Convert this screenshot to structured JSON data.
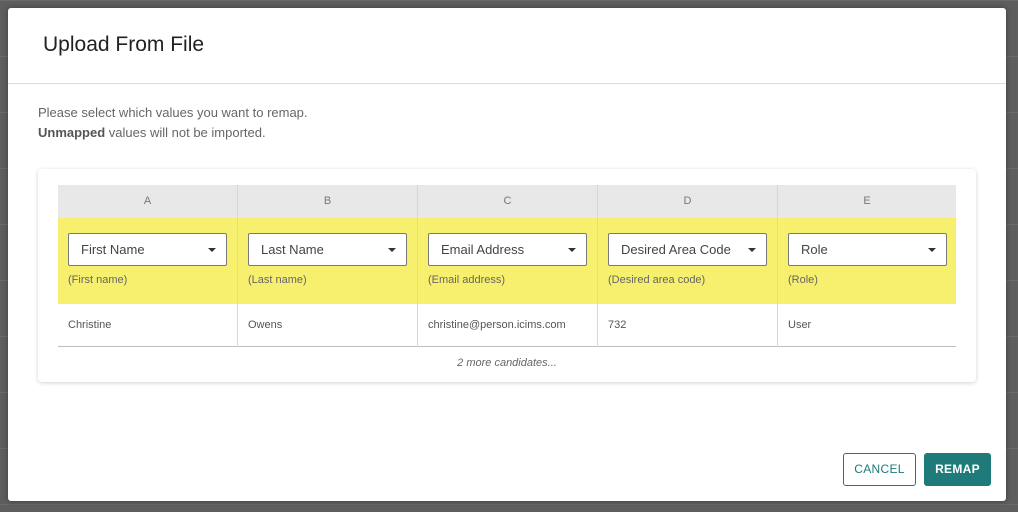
{
  "dialog": {
    "title": "Upload From File",
    "instruction_line1": "Please select which values you want to remap.",
    "instruction_bold": "Unmapped",
    "instruction_line2_rest": " values will not be imported."
  },
  "columns": [
    {
      "letter": "A",
      "selected": "First Name",
      "original": "(First name)",
      "sample": "Christine"
    },
    {
      "letter": "B",
      "selected": "Last Name",
      "original": "(Last name)",
      "sample": "Owens"
    },
    {
      "letter": "C",
      "selected": "Email Address",
      "original": "(Email address)",
      "sample": "christine@person.icims.com"
    },
    {
      "letter": "D",
      "selected": "Desired Area Code",
      "original": "(Desired area code)",
      "sample": "732"
    },
    {
      "letter": "E",
      "selected": "Role",
      "original": "(Role)",
      "sample": "User"
    }
  ],
  "more_text": "2 more candidates...",
  "buttons": {
    "cancel": "CANCEL",
    "remap": "REMAP"
  },
  "colors": {
    "accent": "#1f7a7a",
    "highlight": "#f7ef6e"
  }
}
